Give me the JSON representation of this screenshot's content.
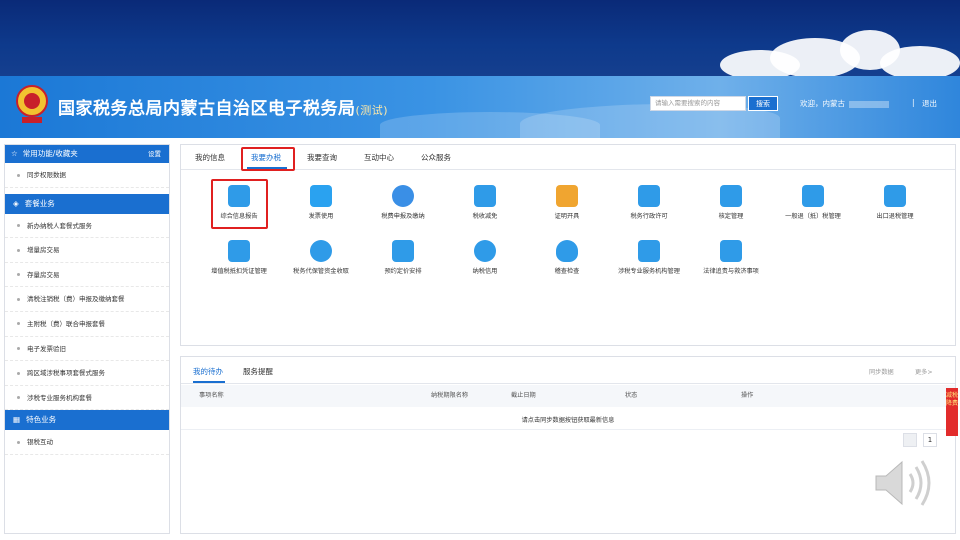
{
  "header": {
    "site_title": "国家税务总局内蒙古自治区电子税务局",
    "test_tag": "(测试)",
    "search_placeholder": "请输入需要搜索的内容",
    "search_button": "搜索",
    "welcome": "欢迎，内蒙古",
    "divider": "|",
    "logout": "退出"
  },
  "sidebar": {
    "favorites_title": "常用功能/收藏夹",
    "settings": "设置",
    "favorites": [
      "同步权限数据"
    ],
    "package_title": "套餐业务",
    "packages": [
      "新办纳税人套餐式服务",
      "增量房交易",
      "存量房交易",
      "清税注销税（费）申报及缴纳套餐",
      "主附税（费）联合申报套餐",
      "电子发票验旧",
      "跨区域涉税事项套餐式服务",
      "涉税专业服务机构套餐"
    ],
    "special_title": "特色业务",
    "specials": [
      "银税互动"
    ]
  },
  "tabs": [
    "我的信息",
    "我要办税",
    "我要查询",
    "互动中心",
    "公众服务"
  ],
  "functions": [
    {
      "label": "综合信息报告",
      "color": "#2f9be8"
    },
    {
      "label": "发票使用",
      "color": "#2aa2f0"
    },
    {
      "label": "税费申报及缴纳",
      "color": "#3a8fe6"
    },
    {
      "label": "税收减免",
      "color": "#2f9be8"
    },
    {
      "label": "证明开具",
      "color": "#f0a530"
    },
    {
      "label": "税务行政许可",
      "color": "#2f9be8"
    },
    {
      "label": "核定管理",
      "color": "#2f9be8"
    },
    {
      "label": "一般退（抵）税管理",
      "color": "#2f9be8"
    },
    {
      "label": "出口退税管理",
      "color": "#2f9be8"
    },
    {
      "label": "增值税抵扣凭证管理",
      "color": "#2f9be8"
    },
    {
      "label": "税务代保管资金收取",
      "color": "#2f9be8"
    },
    {
      "label": "预约定价安排",
      "color": "#2f9be8"
    },
    {
      "label": "纳税信用",
      "color": "#2f9be8"
    },
    {
      "label": "稽查检查",
      "color": "#2f9be8"
    },
    {
      "label": "涉税专业服务机构管理",
      "color": "#2f9be8"
    },
    {
      "label": "法律追责与救济事项",
      "color": "#2f9be8"
    }
  ],
  "todo": {
    "tabs": [
      "我的待办",
      "服务提醒"
    ],
    "sync_link": "同步数据",
    "more_link": "更多>",
    "columns": [
      "事项名称",
      "纳税期限名称",
      "截止日期",
      "状态",
      "操作"
    ],
    "empty_message": "请点击同步数据按钮获取最新信息",
    "page": "1"
  },
  "side_float": "减税降费"
}
